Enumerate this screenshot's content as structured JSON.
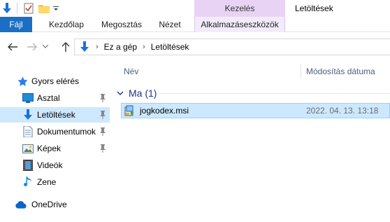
{
  "window": {
    "title": "Letöltések",
    "contextual_group": "Kezelés"
  },
  "ribbon": {
    "tabs": [
      {
        "label": "Fájl"
      },
      {
        "label": "Kezdőlap"
      },
      {
        "label": "Megosztás"
      },
      {
        "label": "Nézet"
      },
      {
        "label": "Alkalmazáseszközök"
      }
    ]
  },
  "address": {
    "breadcrumbs": [
      "Ez a gép",
      "Letöltések"
    ]
  },
  "nav": {
    "quick_access": "Gyors elérés",
    "items": [
      {
        "label": "Asztal",
        "icon": "desktop-icon",
        "pinned": true
      },
      {
        "label": "Letöltések",
        "icon": "download-icon",
        "pinned": true,
        "selected": true
      },
      {
        "label": "Dokumentumok",
        "icon": "documents-icon",
        "pinned": true
      },
      {
        "label": "Képek",
        "icon": "pictures-icon",
        "pinned": true
      },
      {
        "label": "Videók",
        "icon": "videos-icon",
        "pinned": false
      },
      {
        "label": "Zene",
        "icon": "music-icon",
        "pinned": false
      }
    ],
    "onedrive": "OneDrive"
  },
  "content": {
    "columns": {
      "name": "Név",
      "modified": "Módosítás dátuma"
    },
    "groups": [
      {
        "label": "Ma (1)",
        "files": [
          {
            "name": "jogkodex.msi",
            "modified": "2022. 04. 13. 13:18",
            "icon": "msi-installer-icon",
            "selected": true
          }
        ]
      }
    ]
  },
  "colors": {
    "file_tab": "#1a6fc4",
    "contextual": "#e8d3f5",
    "selection": "#cce8ff",
    "group_label": "#1e3287"
  }
}
